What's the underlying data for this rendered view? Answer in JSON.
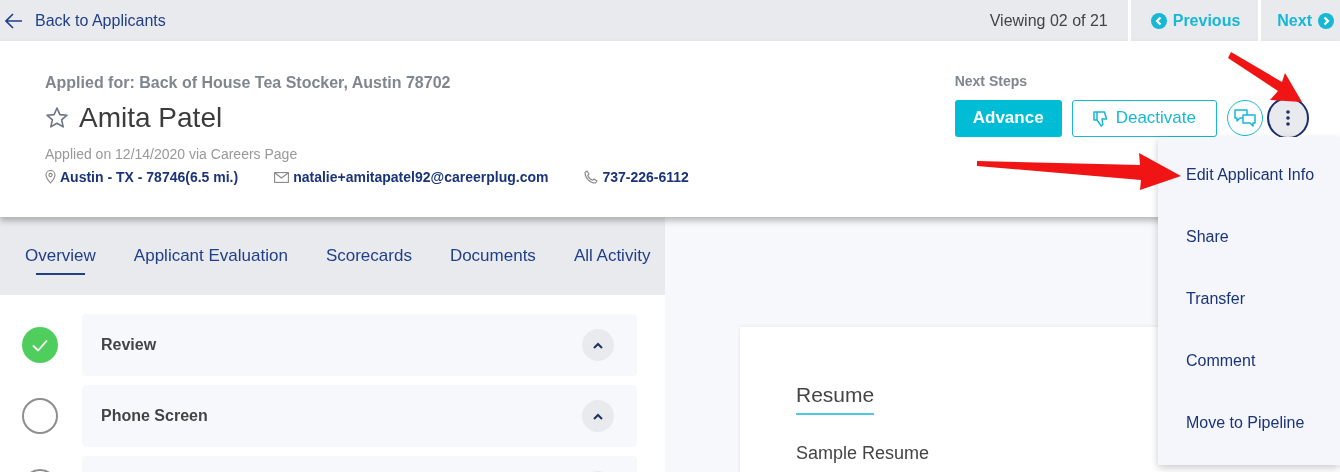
{
  "top_bar": {
    "back_link": "Back to Applicants",
    "viewing": "Viewing 02 of 21",
    "previous": "Previous",
    "next": "Next"
  },
  "applicant": {
    "applied_for": "Applied for: Back of House Tea Stocker, Austin 78702",
    "name": "Amita Patel",
    "starred": false,
    "applied_on": "Applied on 12/14/2020 via Careers Page",
    "contacts": [
      {
        "kind": "location",
        "text": "Austin - TX - 78746(6.5 mi.)"
      },
      {
        "kind": "email",
        "text": "natalie+amitapatel92@careerplug.com"
      },
      {
        "kind": "phone",
        "text": "737-226-6112"
      }
    ]
  },
  "next_steps": {
    "label": "Next Steps",
    "advance": "Advance",
    "deactivate": "Deactivate"
  },
  "tabs": [
    {
      "label": "Overview",
      "selected": true
    },
    {
      "label": "Applicant Evaluation",
      "selected": false
    },
    {
      "label": "Scorecards",
      "selected": false
    },
    {
      "label": "Documents",
      "selected": false
    },
    {
      "label": "All Activity",
      "selected": false
    }
  ],
  "stages": [
    {
      "name": "Review",
      "done": true
    },
    {
      "name": "Phone Screen",
      "done": false
    },
    {
      "done": false
    }
  ],
  "resume": {
    "title": "Resume",
    "subtitle": "Sample Resume"
  },
  "menu": {
    "items": [
      "Edit Applicant Info",
      "Share",
      "Transfer",
      "Comment",
      "Move to Pipeline"
    ]
  }
}
